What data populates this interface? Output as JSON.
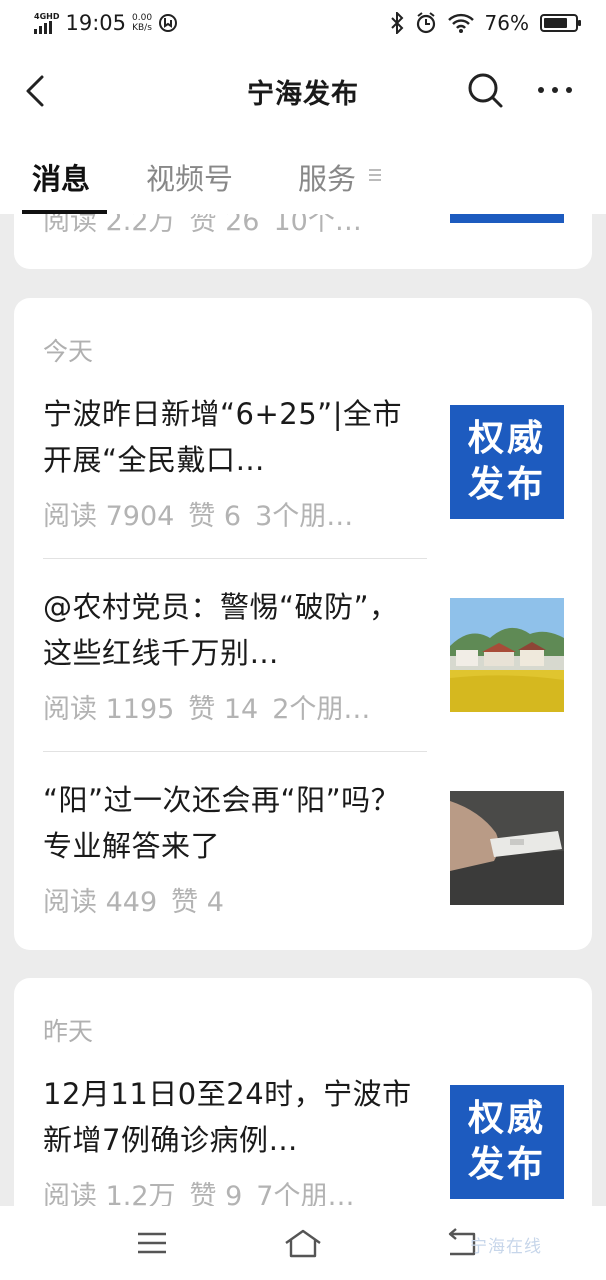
{
  "status_bar": {
    "network": "4GHD",
    "time": "19:05",
    "speed_value": "0.00",
    "speed_unit": "KB/s",
    "battery": "76%",
    "battery_level": 0.76
  },
  "header": {
    "title": "宁海发布"
  },
  "tabs": [
    {
      "label": "消息",
      "active": true
    },
    {
      "label": "视频号",
      "active": false
    },
    {
      "label": "服务",
      "active": false
    }
  ],
  "partial_card": {
    "meta": [
      "阅读 2.2万",
      "赞 26",
      "10个…"
    ]
  },
  "cards": [
    {
      "date": "今天",
      "articles": [
        {
          "title": "宁波昨日新增“6+25”|全市开展“全民戴口…",
          "reads": "阅读 7904",
          "likes": "赞 6",
          "friends": "3个朋…",
          "thumb_text": [
            "权威",
            "发布"
          ]
        },
        {
          "title": "@农村党员：警惕“破防”，这些红线千万别…",
          "reads": "阅读 1195",
          "likes": "赞 14",
          "friends": "2个朋…"
        },
        {
          "title": "“阳”过一次还会再“阳”吗？专业解答来了",
          "reads": "阅读 449",
          "likes": "赞 4",
          "friends": ""
        }
      ]
    },
    {
      "date": "昨天",
      "articles": [
        {
          "title": "12月11日0至24时，宁波市新增7例确诊病例…",
          "reads": "阅读 1.2万",
          "likes": "赞 9",
          "friends": "7个朋…",
          "thumb_text": [
            "权威",
            "发布"
          ]
        }
      ]
    }
  ],
  "watermark": "宁海在线",
  "colors": {
    "authority_blue": "#1d5bbf",
    "page_bg": "#ececec"
  }
}
